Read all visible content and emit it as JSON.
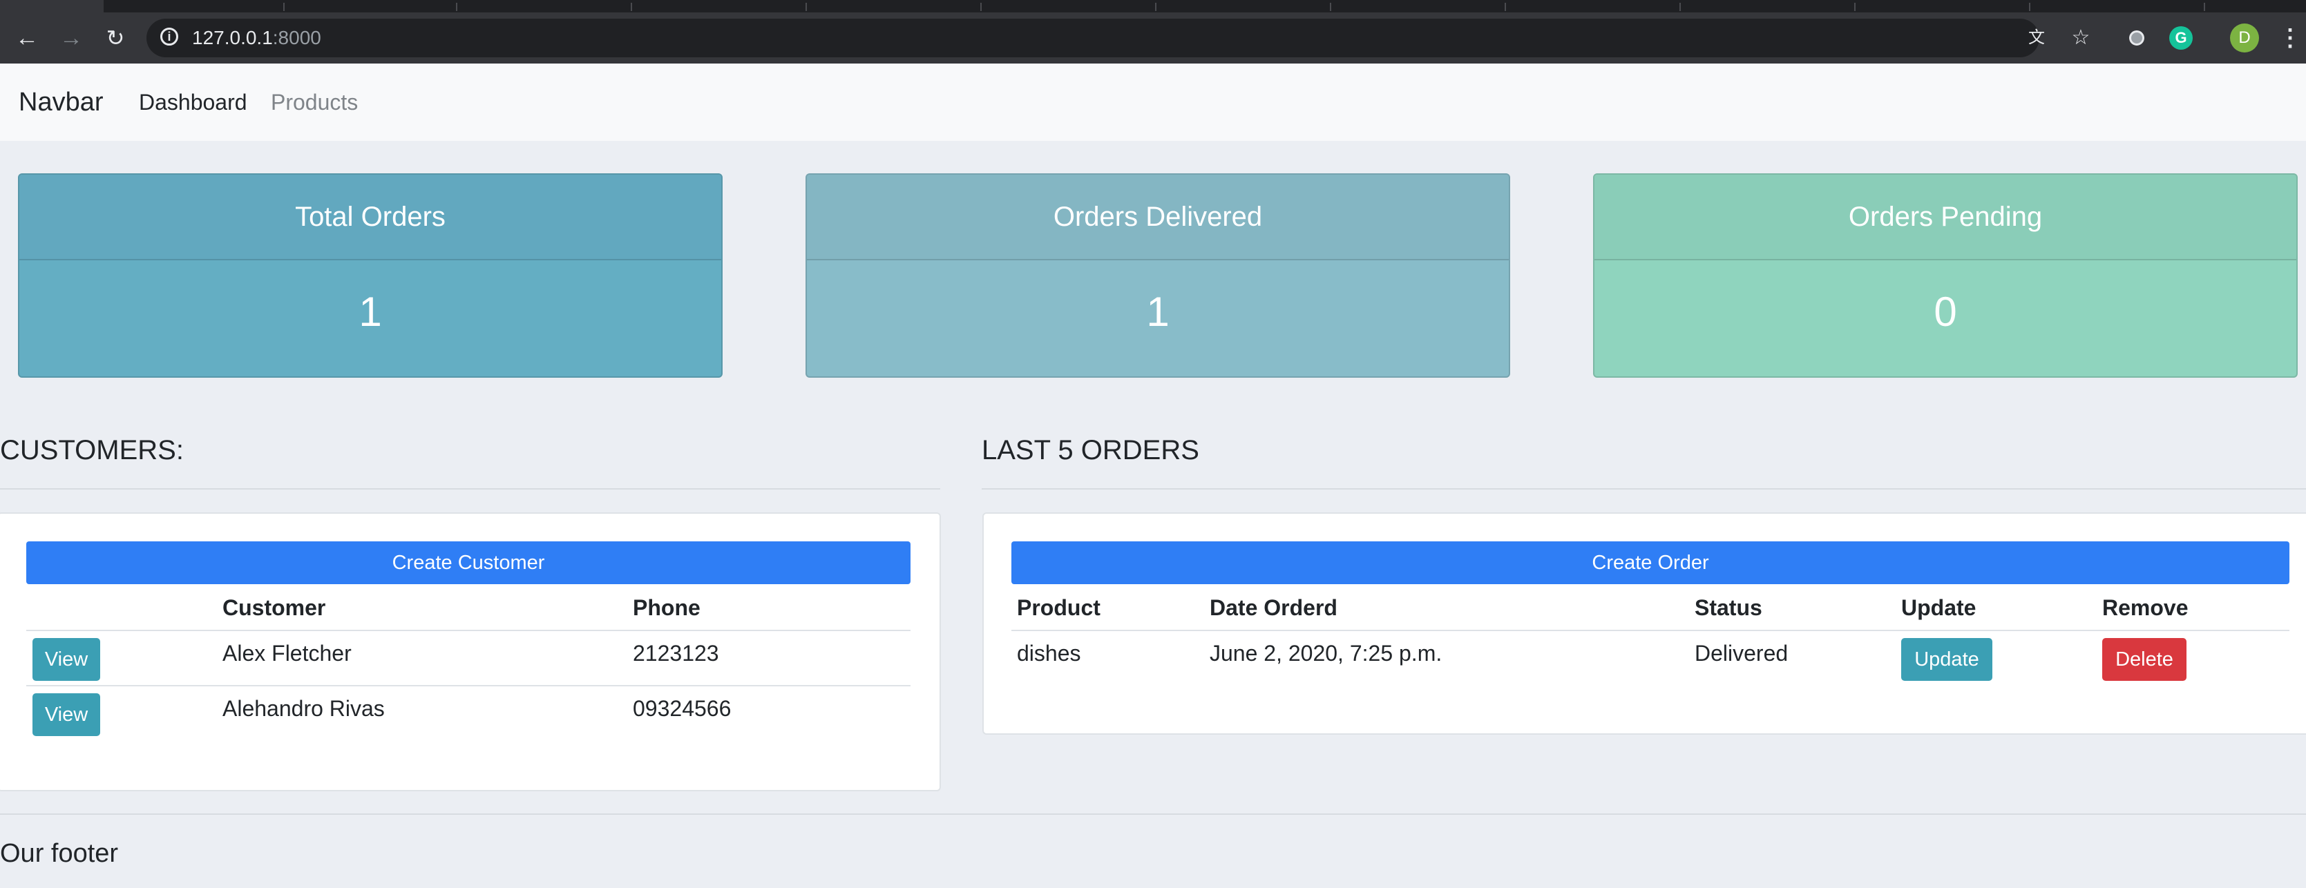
{
  "browser": {
    "url_host": "127.0.0.1",
    "url_port": ":8000"
  },
  "navbar": {
    "brand": "Navbar",
    "links": [
      {
        "label": "Dashboard",
        "active": true
      },
      {
        "label": "Products",
        "active": false
      }
    ]
  },
  "stats": [
    {
      "title": "Total Orders",
      "value": "1",
      "color": "#64aec3"
    },
    {
      "title": "Orders Delivered",
      "value": "1",
      "color": "#86bac8"
    },
    {
      "title": "Orders Pending",
      "value": "0",
      "color": "#8dd3bd"
    }
  ],
  "customers": {
    "title": "CUSTOMERS:",
    "create_label": "Create Customer",
    "columns": [
      "",
      "Customer",
      "Phone"
    ],
    "rows": [
      {
        "action": "View",
        "name": "Alex Fletcher",
        "phone": "2123123"
      },
      {
        "action": "View",
        "name": "Alehandro Rivas",
        "phone": "09324566"
      }
    ]
  },
  "orders": {
    "title": "LAST 5 ORDERS",
    "create_label": "Create Order",
    "columns": [
      "Product",
      "Date Orderd",
      "Status",
      "Update",
      "Remove"
    ],
    "rows": [
      {
        "product": "dishes",
        "date": "June 2, 2020, 7:25 p.m.",
        "status": "Delivered",
        "update_label": "Update",
        "remove_label": "Delete"
      }
    ]
  },
  "footer": {
    "title": "Our footer"
  },
  "colors": {
    "primary": "#2f7ef5",
    "info": "#3b9fb4",
    "danger": "#d9383e",
    "avatar": "#7cb342"
  },
  "avatar_initial": "D"
}
